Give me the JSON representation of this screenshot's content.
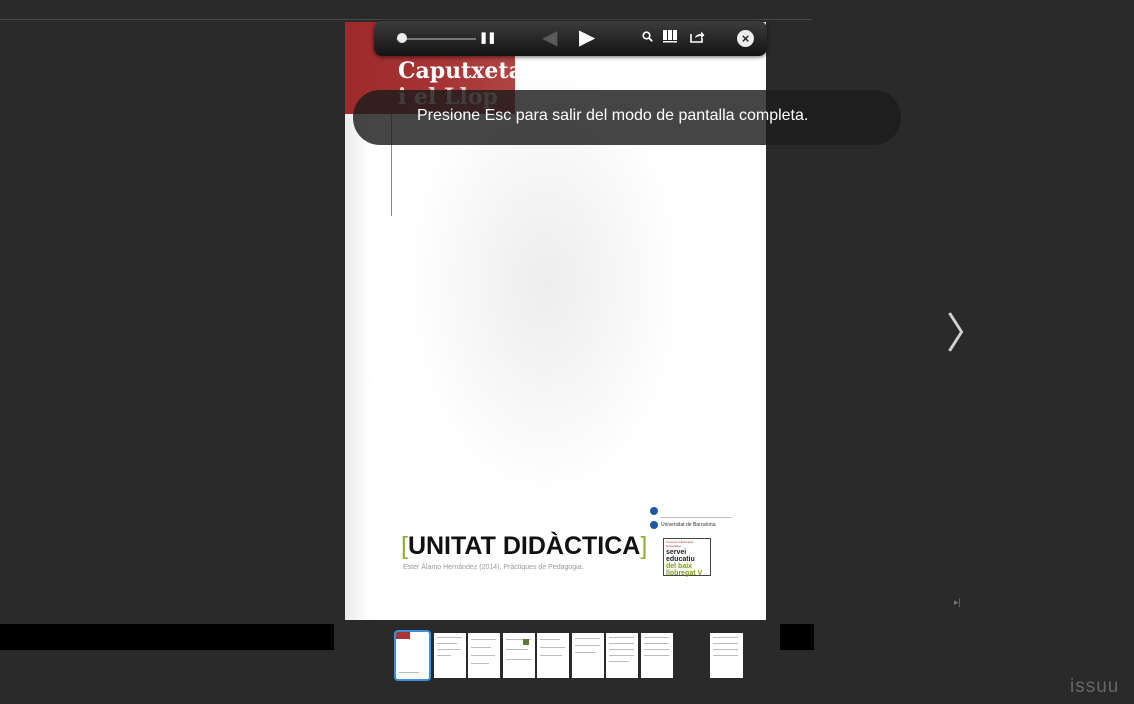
{
  "document": {
    "title_line1": "Caputxeta",
    "title_line2": "i el Llop",
    "heading": "UNITAT DIDÀCTICA",
    "bracket_open": "[",
    "bracket_close": "]",
    "credit": "Ester Álamo Hernández (2014). Pràctiques de Pedagogia.",
    "logo_ub": "Universitat de Barcelona",
    "logo_servei_small": "Consorci d'Educació Generalitat",
    "logo_servei_1": "servei",
    "logo_servei_2": "educatiu",
    "logo_servei_3": "del baix",
    "logo_servei_4": "llobregat V"
  },
  "toolbar": {
    "zoom_minus": "−",
    "pause_icon": "pause-icon",
    "prev_icon": "prev-page-icon",
    "play_icon": "play-icon",
    "search_icon": "search-icon",
    "pages_icon": "pages-icon",
    "share_icon": "share-icon",
    "close_icon": "close-icon",
    "zoom_level": 0.05
  },
  "notice": {
    "text": "Presione Esc para salir del modo de pantalla completa."
  },
  "viewer": {
    "brand": "issuu",
    "next_icon": "next-page-icon",
    "last_page_icon": "last-page-icon"
  },
  "thumbnails": {
    "count": 8,
    "selected": 1
  },
  "colors": {
    "background": "#2a2a2a",
    "accent_red": "#a33535",
    "accent_green": "#8cb03a",
    "selection_blue": "#3c8fd9"
  }
}
